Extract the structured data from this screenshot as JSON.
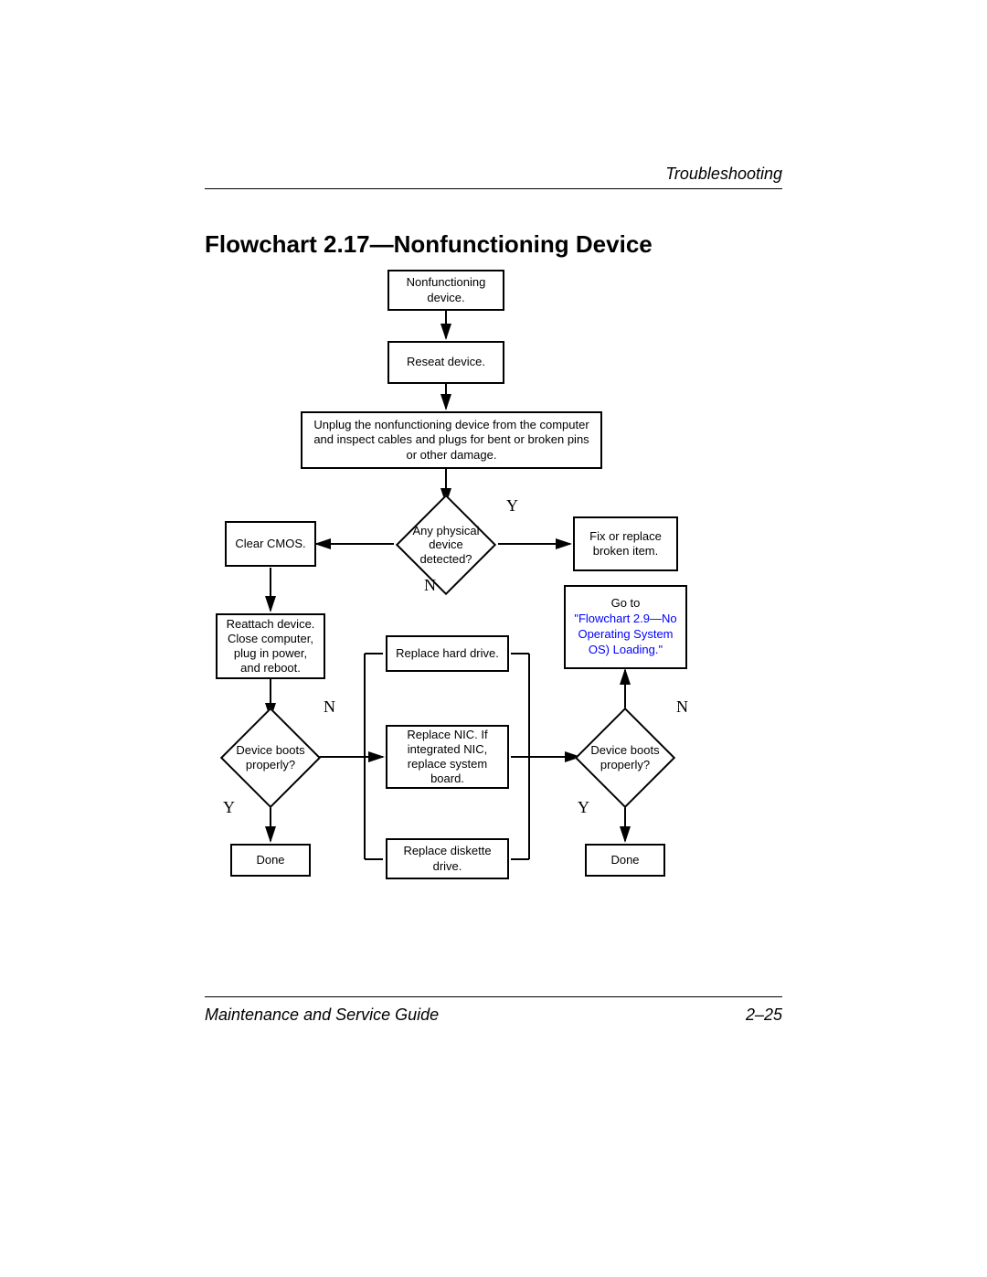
{
  "header": {
    "section": "Troubleshooting"
  },
  "title": "Flowchart 2.17—Nonfunctioning Device",
  "footer": {
    "left": "Maintenance and Service Guide",
    "right": "2–25"
  },
  "nodes": {
    "start": "Nonfunctioning device.",
    "reseat": "Reseat device.",
    "unplug": "Unplug the nonfunctioning device from the computer and inspect cables and plugs for bent or broken pins or other damage.",
    "decision1": "Any physical device detected?",
    "clear_cmos": "Clear CMOS.",
    "fix_replace": "Fix or replace broken item.",
    "reattach": "Reattach device. Close computer, plug in power, and reboot.",
    "goto_prefix": "Go to ",
    "goto_link": "\"Flowchart 2.9—No Operating System OS) Loading.\"",
    "replace_hd": "Replace hard drive.",
    "replace_nic": "Replace NIC. If integrated NIC, replace system board.",
    "replace_diskette": "Replace diskette drive.",
    "decision_left": "Device boots properly?",
    "decision_right": "Device boots properly?",
    "done_left": "Done",
    "done_right": "Done"
  },
  "labels": {
    "Y": "Y",
    "N": "N"
  }
}
